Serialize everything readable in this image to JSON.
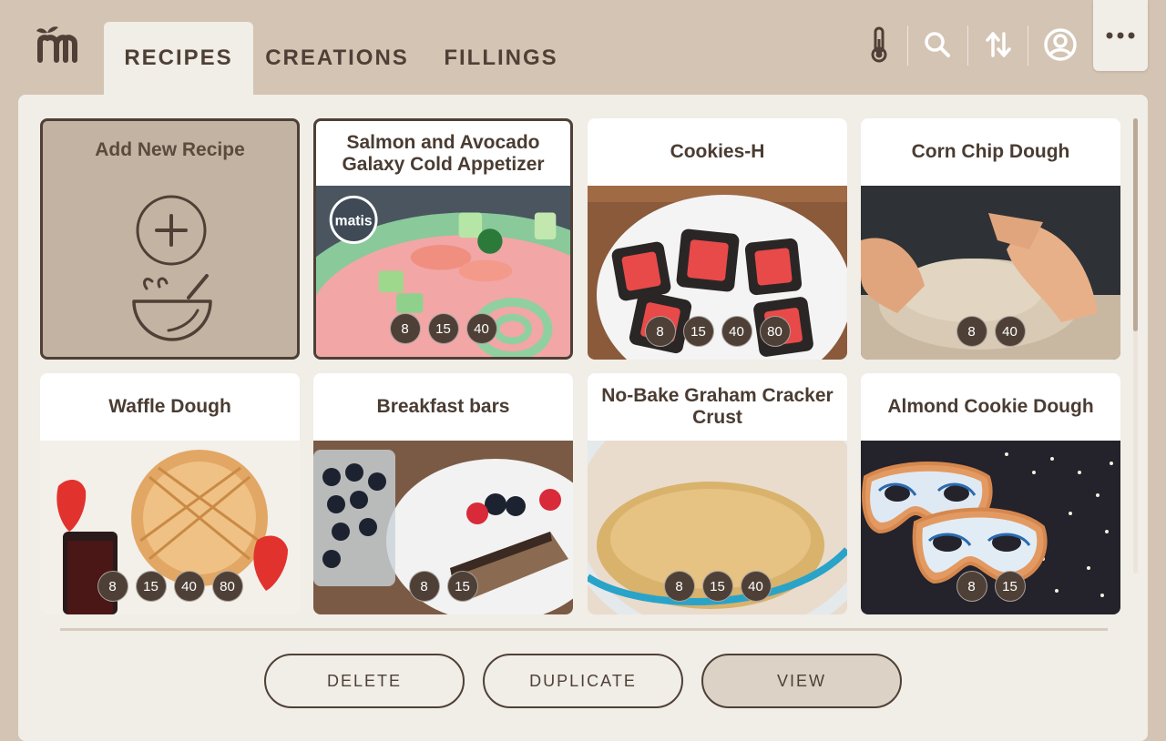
{
  "tabs": [
    {
      "label": "RECIPES",
      "active": true
    },
    {
      "label": "CREATIONS",
      "active": false
    },
    {
      "label": "FILLINGS",
      "active": false
    }
  ],
  "toolbar_icons": [
    "thermometer-icon",
    "search-icon",
    "sort-icon",
    "account-icon",
    "more-icon"
  ],
  "add_card": {
    "label": "Add New Recipe"
  },
  "recipes": [
    {
      "title": "Salmon and Avocado Galaxy Cold Appetizer",
      "badges": [
        "8",
        "15",
        "40"
      ],
      "brand": "matis",
      "selected": true
    },
    {
      "title": "Cookies-H",
      "badges": [
        "8",
        "15",
        "40",
        "80"
      ],
      "selected": false
    },
    {
      "title": "Corn Chip Dough",
      "badges": [
        "8",
        "40"
      ],
      "selected": false
    },
    {
      "title": "Waffle Dough",
      "badges": [
        "8",
        "15",
        "40",
        "80"
      ],
      "selected": false
    },
    {
      "title": "Breakfast bars",
      "badges": [
        "8",
        "15"
      ],
      "selected": false
    },
    {
      "title": "No-Bake Graham Cracker Crust",
      "badges": [
        "8",
        "15",
        "40"
      ],
      "selected": false
    },
    {
      "title": "Almond Cookie Dough",
      "badges": [
        "8",
        "15"
      ],
      "selected": false
    }
  ],
  "actions": {
    "delete": "DELETE",
    "duplicate": "DUPLICATE",
    "view": "VIEW"
  },
  "colors": {
    "background": "#d4c4b3",
    "panel": "#f1ede7",
    "accent_dark": "#4e4036"
  }
}
